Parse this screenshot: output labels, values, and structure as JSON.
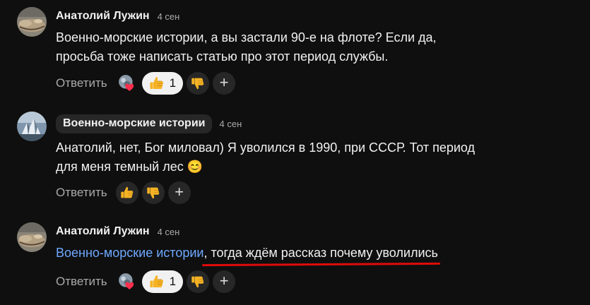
{
  "comments": [
    {
      "author": "Анатолий Лужин",
      "time": "4 сен",
      "text": "Военно-морские истории, а вы застали 90-е на флоте? Если да, просьба тоже написать статью про этот период службы.",
      "reply_label": "Ответить",
      "like_count": "1",
      "avatar_icon": "user-avatar-icon"
    },
    {
      "author": "Военно-морские истории",
      "time": "4 сен",
      "text": "Анатолий, нет, Бог миловал) Я уволился в 1990, при СССР. Тот период для меня темный лес 😊",
      "reply_label": "Ответить",
      "avatar_icon": "channel-avatar-icon"
    },
    {
      "author": "Анатолий Лужин",
      "time": "4 сен",
      "mention": "Военно-морские истории",
      "text_rest": ", тогда ждём рассказ почему уволились",
      "reply_label": "Ответить",
      "like_count": "1",
      "avatar_icon": "user-avatar-icon"
    }
  ],
  "colors": {
    "background": "#0f0f0f",
    "mention": "#6ea8fe",
    "underline": "#e00b0b",
    "like_active_bg": "#f1f1f1",
    "like_icon": "#f5b324"
  }
}
